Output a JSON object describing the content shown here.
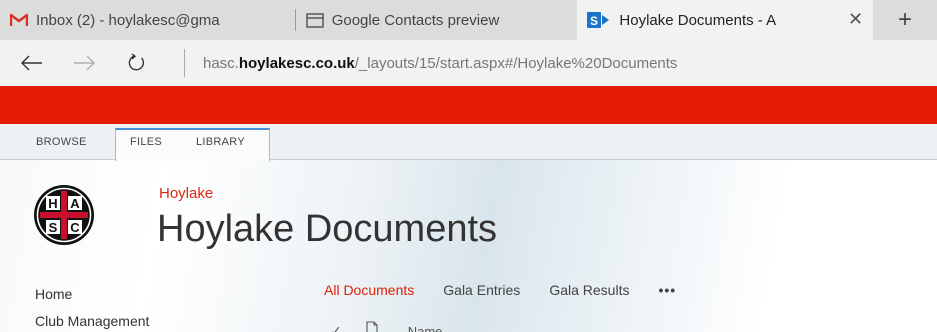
{
  "browser": {
    "tabs": [
      {
        "title": "Inbox (2) - hoylakesc@gma",
        "icon": "gmail-icon",
        "active": false
      },
      {
        "title": "Google Contacts preview",
        "icon": "window-icon",
        "active": false
      },
      {
        "title": "Hoylake Documents - A",
        "icon": "sharepoint-icon",
        "active": true
      }
    ],
    "new_tab_label": "+",
    "close_tab_label": "✕",
    "address": {
      "prefix": "hasc.",
      "domain": "hoylakesc.co.uk",
      "path": "/_layouts/15/start.aspx#/Hoylake%20Documents"
    }
  },
  "colors": {
    "suite_bar": "#e41b05",
    "accent_red": "#e0210a",
    "ribbon_active_border": "#4a90d9"
  },
  "ribbon": {
    "tabs": [
      "BROWSE",
      "FILES",
      "LIBRARY"
    ]
  },
  "site": {
    "logo_letters": [
      "H",
      "A",
      "S",
      "C"
    ],
    "parent_site": "Hoylake",
    "title": "Hoylake Documents"
  },
  "quick_launch": {
    "items": [
      "Home",
      "Club Management"
    ]
  },
  "views": {
    "items": [
      "All Documents",
      "Gala Entries",
      "Gala Results"
    ],
    "active_index": 0,
    "more_label": "•••"
  },
  "list_header": {
    "check_glyph": "✓",
    "name_column": "Name"
  }
}
